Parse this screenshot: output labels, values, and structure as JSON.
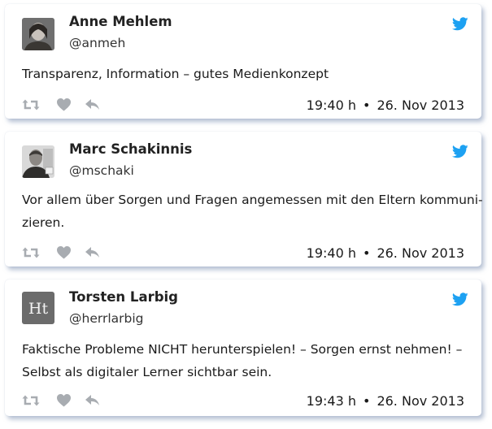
{
  "tweets": [
    {
      "name": "Anne Mehlem",
      "handle": "@anmeh",
      "text_lines": [
        "Transparenz, Information – gutes Medienkonzept"
      ],
      "time": "19:40 h",
      "date": "26. Nov 2013",
      "avatar": "person-photo"
    },
    {
      "name": "Marc Schakinnis",
      "handle": "@mschaki",
      "text_lines": [
        "Vor allem über Sorgen und Fragen angemessen mit den Eltern kommuni-",
        "zieren."
      ],
      "time": "19:40 h",
      "date": "26. Nov 2013",
      "avatar": "person-photo"
    },
    {
      "name": "Torsten Larbig",
      "handle": "@herrlarbig",
      "text_lines": [
        "Faktische Probleme NICHT herunterspielen! – Sorgen ernst nehmen! –",
        "Selbst als digitaler Lerner sichtbar sein."
      ],
      "time": "19:43 h",
      "date": "26. Nov 2013",
      "avatar": "monogram",
      "avatar_text": "Ht"
    }
  ],
  "icons": {
    "brand": "twitter-bird-icon",
    "actions": [
      "retweet-icon",
      "heart-icon",
      "reply-icon"
    ]
  },
  "colors": {
    "twitter_blue": "#1da1f2",
    "action_gray": "#a8acb1"
  }
}
